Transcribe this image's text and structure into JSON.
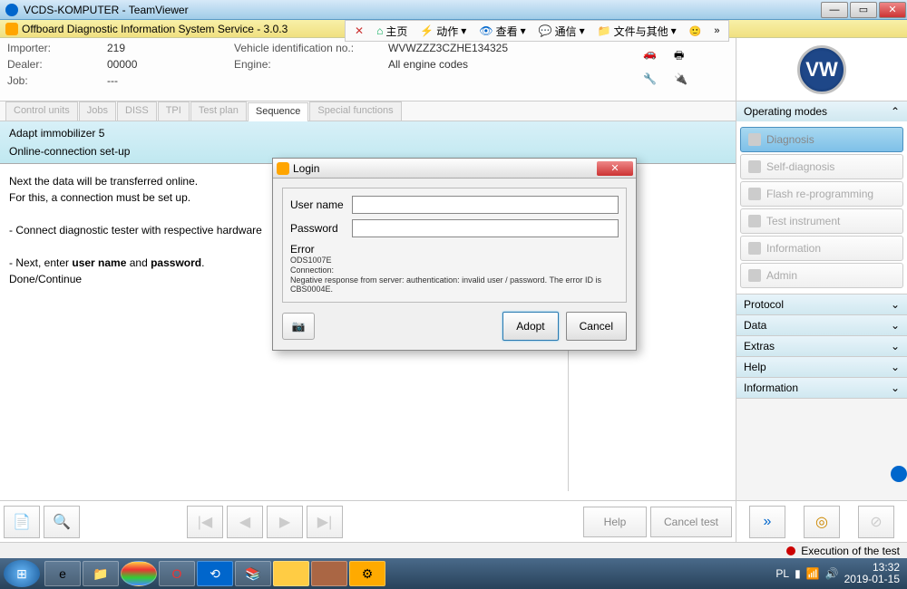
{
  "titlebar": {
    "title": "VCDS-KOMPUTER - TeamViewer"
  },
  "subtitle": {
    "text": "Offboard Diagnostic Information System Service - 3.0.3"
  },
  "browser_toolbar": {
    "home": "主页",
    "action": "动作",
    "view": "查看",
    "comm": "通信",
    "files": "文件与其他"
  },
  "header": {
    "importer_label": "Importer:",
    "importer_val": "219",
    "dealer_label": "Dealer:",
    "dealer_val": "00000",
    "job_label": "Job:",
    "job_val": "---",
    "vin_label": "Vehicle identification no.:",
    "vin_val": "WVWZZZ3CZHE134325",
    "engine_label": "Engine:",
    "engine_val": "All engine codes"
  },
  "tabs": [
    "Control units",
    "Jobs",
    "DISS",
    "TPI",
    "Test plan",
    "Sequence",
    "Special functions"
  ],
  "active_tab": "Sequence",
  "sequence": {
    "title": "Adapt immobilizer 5",
    "subtitle": "Online-connection set-up",
    "l1": "Next the data will be transferred online.",
    "l2": "For this, a connection must be set up.",
    "l3": "- Connect diagnostic tester with respective hardware",
    "l4a": "- Next, enter ",
    "l4b": "user name",
    "l4c": " and ",
    "l4d": "password",
    "l4e": ".",
    "l5": "Done/Continue"
  },
  "bottom": {
    "help": "Help",
    "cancel": "Cancel test"
  },
  "side": {
    "modes_title": "Operating modes",
    "modes": [
      "Diagnosis",
      "Self-diagnosis",
      "Flash re-programming",
      "Test instrument",
      "Information",
      "Admin"
    ],
    "sections": [
      "Protocol",
      "Data",
      "Extras",
      "Help",
      "Information"
    ]
  },
  "status": {
    "text": "Execution of the test"
  },
  "dialog": {
    "title": "Login",
    "user_label": "User name",
    "pass_label": "Password",
    "error_title": "Error",
    "error_code": "ODS1007E",
    "error_conn": "Connection:",
    "error_msg": "Negative response from server: authentication: invalid user / password. The error ID is CBS0004E.",
    "adopt": "Adopt",
    "cancel": "Cancel"
  },
  "tray": {
    "lang": "PL",
    "time": "13:32",
    "date": "2019-01-15"
  }
}
